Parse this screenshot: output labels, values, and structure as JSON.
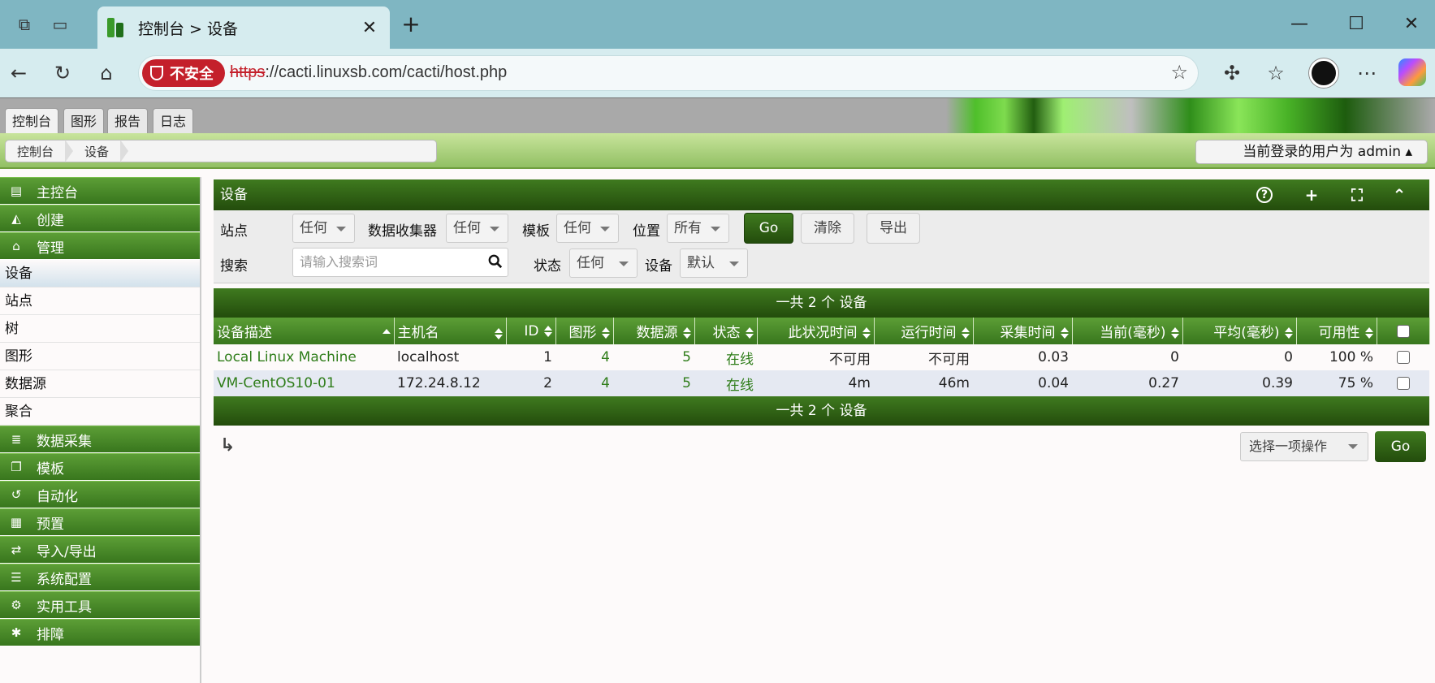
{
  "browser": {
    "tab_title": "控制台 > 设备",
    "insecure_label": "不安全",
    "url_protocol": "https",
    "url_rest": "://cacti.linuxsb.com/cacti/host.php"
  },
  "cacti": {
    "top_tabs": [
      "控制台",
      "图形",
      "报告",
      "日志"
    ],
    "breadcrumb": [
      "控制台",
      "设备"
    ],
    "user_label": "当前登录的用户为 admin ▴"
  },
  "sidebar": {
    "sections_top": [
      {
        "label": "主控台",
        "icon": "map-icon"
      },
      {
        "label": "创建",
        "icon": "chart-area-icon"
      },
      {
        "label": "管理",
        "icon": "home-icon"
      }
    ],
    "items": [
      "设备",
      "站点",
      "树",
      "图形",
      "数据源",
      "聚合"
    ],
    "sections_bottom": [
      {
        "label": "数据采集",
        "icon": "database-icon"
      },
      {
        "label": "模板",
        "icon": "clone-icon"
      },
      {
        "label": "自动化",
        "icon": "refresh-icon"
      },
      {
        "label": "预置",
        "icon": "archive-icon"
      },
      {
        "label": "导入/导出",
        "icon": "exchange-icon"
      },
      {
        "label": "系统配置",
        "icon": "sliders-icon"
      },
      {
        "label": "实用工具",
        "icon": "cogs-icon"
      },
      {
        "label": "排障",
        "icon": "bug-icon"
      }
    ]
  },
  "panel": {
    "title": "设备",
    "filters": {
      "site_label": "站点",
      "site_value": "任何",
      "collector_label": "数据收集器",
      "collector_value": "任何",
      "template_label": "模板",
      "template_value": "任何",
      "location_label": "位置",
      "location_value": "所有",
      "go": "Go",
      "clear": "清除",
      "export": "导出",
      "search_label": "搜索",
      "search_placeholder": "请输入搜索词",
      "status_label": "状态",
      "status_value": "任何",
      "devices_label": "设备",
      "devices_value": "默认"
    }
  },
  "table": {
    "summary": "一共 2 个 设备",
    "headers": [
      "设备描述",
      "主机名",
      "ID",
      "图形",
      "数据源",
      "状态",
      "此状况时间",
      "运行时间",
      "采集时间",
      "当前(毫秒)",
      "平均(毫秒)",
      "可用性"
    ],
    "rows": [
      {
        "desc": "Local Linux Machine",
        "host": "localhost",
        "id": "1",
        "graphs": "4",
        "ds": "5",
        "status": "在线",
        "state_time": "不可用",
        "uptime": "不可用",
        "poll": "0.03",
        "cur": "0",
        "avg": "0",
        "avail": "100 %"
      },
      {
        "desc": "VM-CentOS10-01",
        "host": "172.24.8.12",
        "id": "2",
        "graphs": "4",
        "ds": "5",
        "status": "在线",
        "state_time": "4m",
        "uptime": "46m",
        "poll": "0.04",
        "cur": "0.27",
        "avg": "0.39",
        "avail": "75 %"
      }
    ]
  },
  "actions": {
    "select_label": "选择一项操作",
    "go": "Go"
  },
  "colors": {
    "cacti_green": "#38761d",
    "cacti_dark_green": "#234c0c",
    "link_green": "#2f7d1a",
    "insecure_red": "#c4202b"
  }
}
